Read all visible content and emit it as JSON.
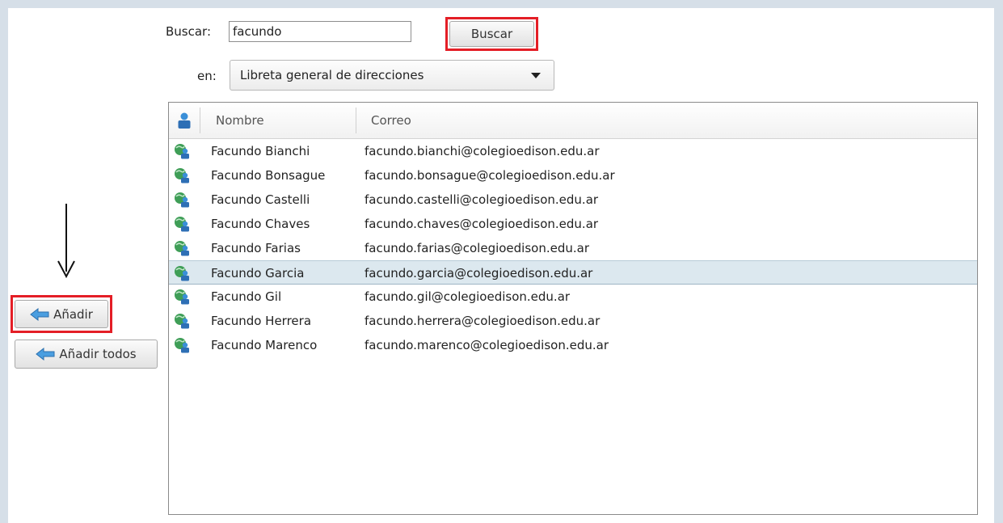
{
  "search": {
    "label": "Buscar:",
    "value": "facundo",
    "button_label": "Buscar"
  },
  "scope": {
    "label": "en:",
    "selected": "Libreta general de direcciones"
  },
  "list": {
    "columns": [
      "Nombre",
      "Correo"
    ],
    "rows": [
      {
        "name": "Facundo Bianchi",
        "email": "facundo.bianchi@colegioedison.edu.ar"
      },
      {
        "name": "Facundo Bonsague",
        "email": "facundo.bonsague@colegioedison.edu.ar"
      },
      {
        "name": "Facundo Castelli",
        "email": "facundo.castelli@colegioedison.edu.ar"
      },
      {
        "name": "Facundo Chaves",
        "email": "facundo.chaves@colegioedison.edu.ar"
      },
      {
        "name": "Facundo Farias",
        "email": "facundo.farias@colegioedison.edu.ar"
      },
      {
        "name": "Facundo Garcia",
        "email": "facundo.garcia@colegioedison.edu.ar"
      },
      {
        "name": "Facundo Gil",
        "email": "facundo.gil@colegioedison.edu.ar"
      },
      {
        "name": "Facundo Herrera",
        "email": "facundo.herrera@colegioedison.edu.ar"
      },
      {
        "name": "Facundo Marenco",
        "email": "facundo.marenco@colegioedison.edu.ar"
      }
    ],
    "selected_index": 5
  },
  "actions": {
    "add_label": "Añadir",
    "add_all_label": "Añadir todos"
  },
  "icons": {
    "header": "contact-icon",
    "row": "global-contact-icon",
    "button": "left-arrow-icon",
    "annotation": "down-arrow-icon"
  },
  "colors": {
    "highlight": "#e41e26",
    "selection": "#dce8ef",
    "icon_blue": "#3a8fd8"
  }
}
